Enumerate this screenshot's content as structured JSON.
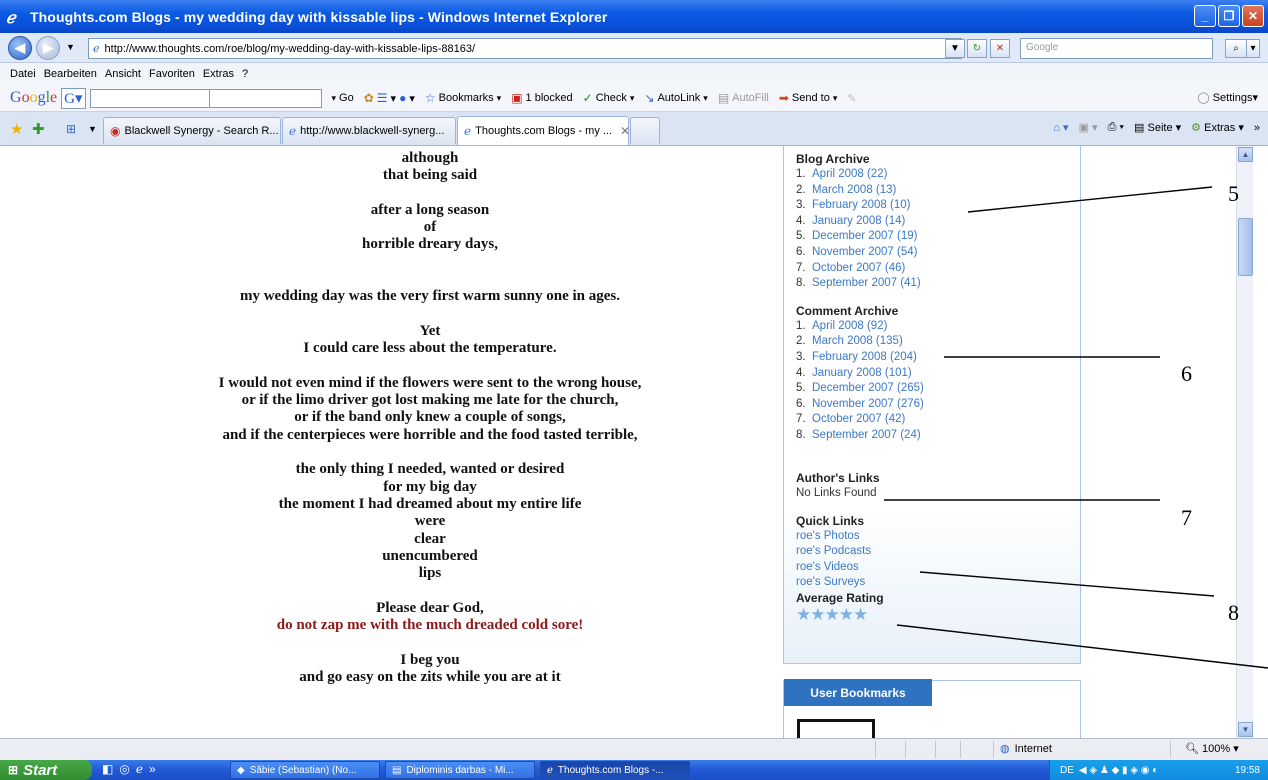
{
  "window": {
    "title": "Thoughts.com Blogs - my wedding day with kissable lips - Windows Internet Explorer",
    "controls": [
      "_",
      "❐",
      "✕"
    ]
  },
  "address": {
    "url": "http://www.thoughts.com/roe/blog/my-wedding-day-with-kissable-lips-88163/",
    "search_placeholder": "Google"
  },
  "menu": [
    "Datei",
    "Bearbeiten",
    "Ansicht",
    "Favoriten",
    "Extras",
    "?"
  ],
  "google_toolbar": {
    "logo": [
      "G",
      "o",
      "o",
      "g",
      "l",
      "e"
    ],
    "go": "Go",
    "items": [
      "Bookmarks",
      "1 blocked",
      "Check",
      "AutoLink",
      "AutoFill",
      "Send to"
    ],
    "settings": "Settings"
  },
  "tabs": [
    {
      "label": "Blackwell Synergy - Search R..."
    },
    {
      "label": "http://www.blackwell-synerg..."
    },
    {
      "label": "Thoughts.com Blogs - my ..."
    }
  ],
  "command_bar": [
    "Seite",
    "Extras"
  ],
  "poem": [
    {
      "text": "although"
    },
    {
      "text": "that being said"
    },
    {
      "text": ""
    },
    {
      "text": "after a long season"
    },
    {
      "text": "of"
    },
    {
      "text": "horrible dreary days,"
    },
    {
      "text": ""
    },
    {
      "text": ""
    },
    {
      "text": "my wedding day was the very first warm sunny one in ages."
    },
    {
      "text": ""
    },
    {
      "text": "Yet"
    },
    {
      "text": "I could care less about the temperature."
    },
    {
      "text": ""
    },
    {
      "text": "I would not even mind if the flowers were sent to the wrong house,"
    },
    {
      "text": "or if the limo driver got lost making me late for the church,"
    },
    {
      "text": "or if the band only knew a couple of songs,"
    },
    {
      "text": "and if the centerpieces were horrible and the food tasted terrible,"
    },
    {
      "text": ""
    },
    {
      "text": "the only thing I needed, wanted or desired"
    },
    {
      "text": "for my big day"
    },
    {
      "text": "the moment I had dreamed about my entire life"
    },
    {
      "text": "were"
    },
    {
      "text": "clear"
    },
    {
      "text": "unencumbered"
    },
    {
      "text": "lips"
    },
    {
      "text": ""
    },
    {
      "text": "Please dear God,"
    },
    {
      "text": "do not zap me with the much dreaded cold sore!"
    },
    {
      "text": ""
    },
    {
      "text": "I beg you"
    },
    {
      "text": "and go easy on the zits while you are at it"
    }
  ],
  "sidebar": {
    "blog_archive": {
      "heading": "Blog Archive",
      "items": [
        {
          "num": "1.",
          "label": "April 2008 (22)"
        },
        {
          "num": "2.",
          "label": "March 2008 (13)"
        },
        {
          "num": "3.",
          "label": "February 2008 (10)"
        },
        {
          "num": "4.",
          "label": "January 2008 (14)"
        },
        {
          "num": "5.",
          "label": "December 2007 (19)"
        },
        {
          "num": "6.",
          "label": "November 2007 (54)"
        },
        {
          "num": "7.",
          "label": "October 2007 (46)"
        },
        {
          "num": "8.",
          "label": "September 2007 (41)"
        }
      ]
    },
    "comment_archive": {
      "heading": "Comment Archive",
      "items": [
        {
          "num": "1.",
          "label": "April 2008 (92)"
        },
        {
          "num": "2.",
          "label": "March 2008 (135)"
        },
        {
          "num": "3.",
          "label": "February 2008 (204)"
        },
        {
          "num": "4.",
          "label": "January 2008 (101)"
        },
        {
          "num": "5.",
          "label": "December 2007 (265)"
        },
        {
          "num": "6.",
          "label": "November 2007 (276)"
        },
        {
          "num": "7.",
          "label": "October 2007 (42)"
        },
        {
          "num": "8.",
          "label": "September 2007 (24)"
        }
      ]
    },
    "authors_links": {
      "heading": "Author's Links",
      "text": "No Links Found"
    },
    "quick_links": {
      "heading": "Quick Links",
      "items": [
        "roe's Photos",
        "roe's Podcasts",
        "roe's Videos",
        "roe's Surveys"
      ]
    },
    "rating": {
      "heading": "Average Rating",
      "stars": "★★★★★",
      "value": 0
    },
    "user_bookmarks": "User Bookmarks"
  },
  "annotations": [
    "5",
    "6",
    "7",
    "8"
  ],
  "status_bar": {
    "zone": "Internet",
    "zoom": "100%"
  },
  "taskbar": {
    "start": "Start",
    "tasks": [
      {
        "label": "Săbie (Sebastian) (No..."
      },
      {
        "label": "Diplominis darbas - Mi..."
      },
      {
        "label": "Thoughts.com Blogs -..."
      }
    ],
    "lang": "DE",
    "clock": "19:58"
  }
}
